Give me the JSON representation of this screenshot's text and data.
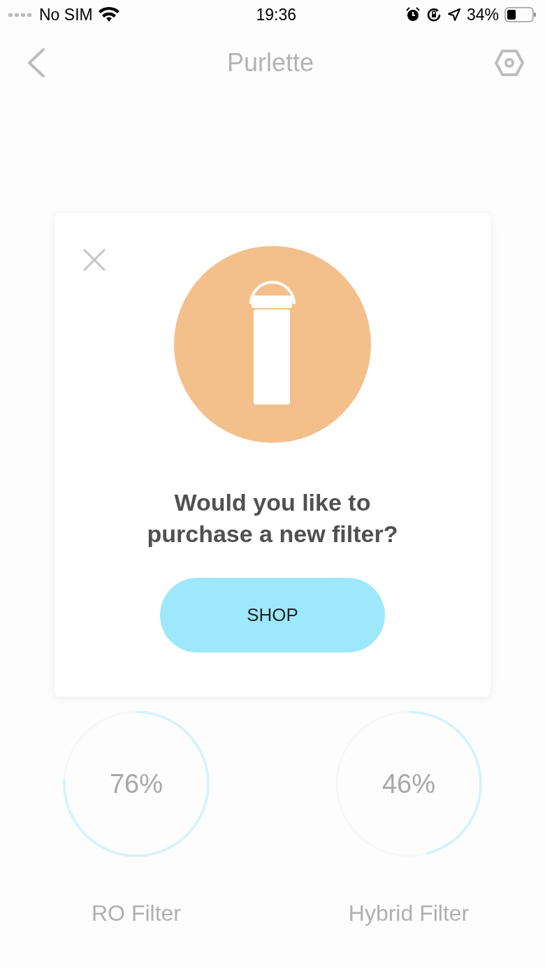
{
  "status_bar": {
    "carrier": "No SIM",
    "time": "19:36",
    "battery": "34%"
  },
  "nav": {
    "title": "Purlette"
  },
  "dialog": {
    "question": "Would you like to purchase a new filter?",
    "button": "SHOP"
  },
  "filters": [
    {
      "reading": "76%",
      "level": 0.76,
      "name": "RO Filter"
    },
    {
      "reading": "46%",
      "level": 0.46,
      "name": "Hybrid Filter"
    }
  ]
}
